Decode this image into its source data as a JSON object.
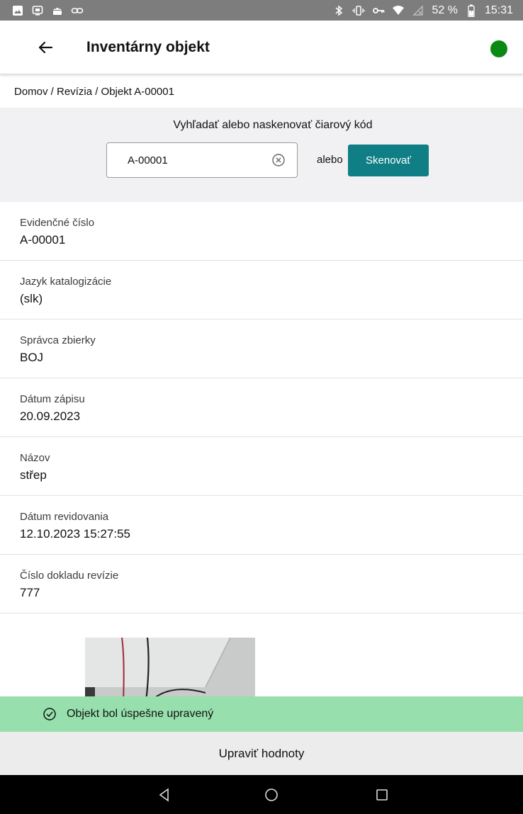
{
  "status_bar": {
    "left_icons": [
      "image-icon",
      "cast-icon",
      "android-icon",
      "link-icon"
    ],
    "right_icons": [
      "bluetooth-icon",
      "vibrate-icon",
      "vpn-key-icon",
      "wifi-icon",
      "no-signal-icon"
    ],
    "battery": "52 %",
    "time": "15:31"
  },
  "app_bar": {
    "title": "Inventárny objekt",
    "status_color": "#0a8a12"
  },
  "breadcrumb": "Domov / Revízia / Objekt A-00001",
  "search": {
    "heading": "Vyhľadať alebo naskenovať čiarový kód",
    "value": "A-00001",
    "or_label": "alebo",
    "scan_button": "Skenovať"
  },
  "fields": [
    {
      "label": "Evidenčné číslo",
      "value": "A-00001"
    },
    {
      "label": "Jazyk katalogizácie",
      "value": "(slk)"
    },
    {
      "label": "Správca zbierky",
      "value": "BOJ"
    },
    {
      "label": "Dátum zápisu",
      "value": "20.09.2023"
    },
    {
      "label": "Názov",
      "value": "střep"
    },
    {
      "label": "Dátum revidovania",
      "value": "12.10.2023 15:27:55"
    },
    {
      "label": "Číslo dokladu revízie",
      "value": "777"
    }
  ],
  "toast": {
    "message": "Objekt bol úspešne upravený",
    "color": "#97e0ad"
  },
  "edit_button": "Upraviť hodnoty",
  "accent_color": "#0f7f85"
}
